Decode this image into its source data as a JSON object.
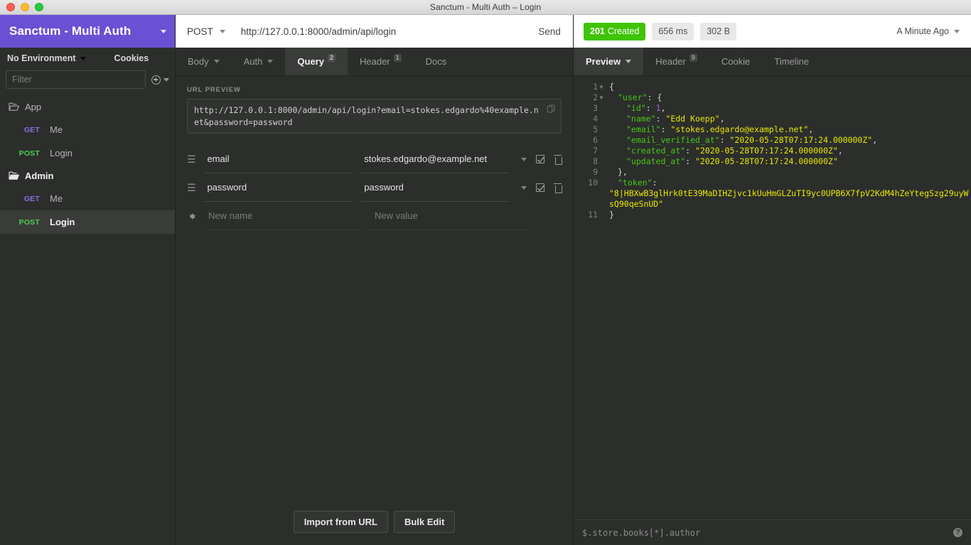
{
  "window": {
    "title": "Sanctum - Multi Auth – Login"
  },
  "sidebar": {
    "workspace": "Sanctum - Multi Auth",
    "environment": "No Environment",
    "cookies_label": "Cookies",
    "filter_placeholder": "Filter",
    "tree": [
      {
        "type": "folder",
        "name": "App",
        "icon": "folder-open-outline-icon",
        "active": false
      },
      {
        "type": "request",
        "method": "GET",
        "name": "Me",
        "selected": false
      },
      {
        "type": "request",
        "method": "POST",
        "name": "Login",
        "selected": false
      },
      {
        "type": "folder",
        "name": "Admin",
        "icon": "folder-filled-icon",
        "active": true
      },
      {
        "type": "request",
        "method": "GET",
        "name": "Me",
        "selected": false
      },
      {
        "type": "request",
        "method": "POST",
        "name": "Login",
        "selected": true
      }
    ]
  },
  "request": {
    "method": "POST",
    "url": "http://127.0.0.1:8000/admin/api/login",
    "send_label": "Send",
    "tabs": [
      {
        "label": "Body",
        "badge": "",
        "caret": true,
        "active": false
      },
      {
        "label": "Auth",
        "badge": "",
        "caret": true,
        "active": false
      },
      {
        "label": "Query",
        "badge": "2",
        "caret": false,
        "active": true
      },
      {
        "label": "Header",
        "badge": "1",
        "caret": false,
        "active": false
      },
      {
        "label": "Docs",
        "badge": "",
        "caret": false,
        "active": false
      }
    ],
    "url_preview_label": "URL PREVIEW",
    "url_preview": "http://127.0.0.1:8000/admin/api/login?email=stokes.edgardo%40example.net&password=password",
    "params": [
      {
        "name": "email",
        "value": "stokes.edgardo@example.net",
        "enabled": true
      },
      {
        "name": "password",
        "value": "password",
        "enabled": true
      }
    ],
    "new_param": {
      "name_placeholder": "New name",
      "value_placeholder": "New value"
    },
    "footer": {
      "import_label": "Import from URL",
      "bulk_edit_label": "Bulk Edit"
    }
  },
  "response": {
    "status_code": "201",
    "status_text": "Created",
    "time": "656 ms",
    "size": "302 B",
    "time_ago": "A Minute Ago",
    "tabs": [
      {
        "label": "Preview",
        "badge": "",
        "caret": true,
        "active": true
      },
      {
        "label": "Header",
        "badge": "9",
        "caret": false,
        "active": false
      },
      {
        "label": "Cookie",
        "badge": "",
        "caret": false,
        "active": false
      },
      {
        "label": "Timeline",
        "badge": "",
        "caret": false,
        "active": false
      }
    ],
    "body_lines": [
      {
        "n": "1",
        "fold": true,
        "indent": 0,
        "tokens": [
          {
            "t": "p",
            "v": "{"
          }
        ]
      },
      {
        "n": "2",
        "fold": true,
        "indent": 1,
        "tokens": [
          {
            "t": "k",
            "v": "\"user\""
          },
          {
            "t": "p",
            "v": ": {"
          }
        ]
      },
      {
        "n": "3",
        "fold": false,
        "indent": 2,
        "tokens": [
          {
            "t": "k",
            "v": "\"id\""
          },
          {
            "t": "p",
            "v": ": "
          },
          {
            "t": "n",
            "v": "1"
          },
          {
            "t": "p",
            "v": ","
          }
        ]
      },
      {
        "n": "4",
        "fold": false,
        "indent": 2,
        "tokens": [
          {
            "t": "k",
            "v": "\"name\""
          },
          {
            "t": "p",
            "v": ": "
          },
          {
            "t": "s",
            "v": "\"Edd Koepp\""
          },
          {
            "t": "p",
            "v": ","
          }
        ]
      },
      {
        "n": "5",
        "fold": false,
        "indent": 2,
        "tokens": [
          {
            "t": "k",
            "v": "\"email\""
          },
          {
            "t": "p",
            "v": ": "
          },
          {
            "t": "s",
            "v": "\"stokes.edgardo@example.net\""
          },
          {
            "t": "p",
            "v": ","
          }
        ]
      },
      {
        "n": "6",
        "fold": false,
        "indent": 2,
        "tokens": [
          {
            "t": "k",
            "v": "\"email_verified_at\""
          },
          {
            "t": "p",
            "v": ": "
          },
          {
            "t": "s",
            "v": "\"2020-05-28T07:17:24.000000Z\""
          },
          {
            "t": "p",
            "v": ","
          }
        ]
      },
      {
        "n": "7",
        "fold": false,
        "indent": 2,
        "tokens": [
          {
            "t": "k",
            "v": "\"created_at\""
          },
          {
            "t": "p",
            "v": ": "
          },
          {
            "t": "s",
            "v": "\"2020-05-28T07:17:24.000000Z\""
          },
          {
            "t": "p",
            "v": ","
          }
        ]
      },
      {
        "n": "8",
        "fold": false,
        "indent": 2,
        "tokens": [
          {
            "t": "k",
            "v": "\"updated_at\""
          },
          {
            "t": "p",
            "v": ": "
          },
          {
            "t": "s",
            "v": "\"2020-05-28T07:17:24.000000Z\""
          }
        ]
      },
      {
        "n": "9",
        "fold": false,
        "indent": 1,
        "tokens": [
          {
            "t": "p",
            "v": "},"
          }
        ]
      },
      {
        "n": "10",
        "fold": false,
        "indent": 1,
        "tokens": [
          {
            "t": "k",
            "v": "\"token\""
          },
          {
            "t": "p",
            "v": ":"
          }
        ]
      },
      {
        "n": "",
        "fold": false,
        "indent": 0,
        "tokens": [
          {
            "t": "s",
            "v": "\"8|HBXwB3glHrk0tE39MaDIHZjvc1kUuHmGLZuTI9yc0UPB6X7fpV2KdM4hZeYtegSzg29uyWsQ90qeSnUD\""
          }
        ]
      },
      {
        "n": "11",
        "fold": false,
        "indent": 0,
        "tokens": [
          {
            "t": "p",
            "v": "}"
          }
        ]
      }
    ],
    "jsonpath_placeholder": "$.store.books[*].author"
  }
}
